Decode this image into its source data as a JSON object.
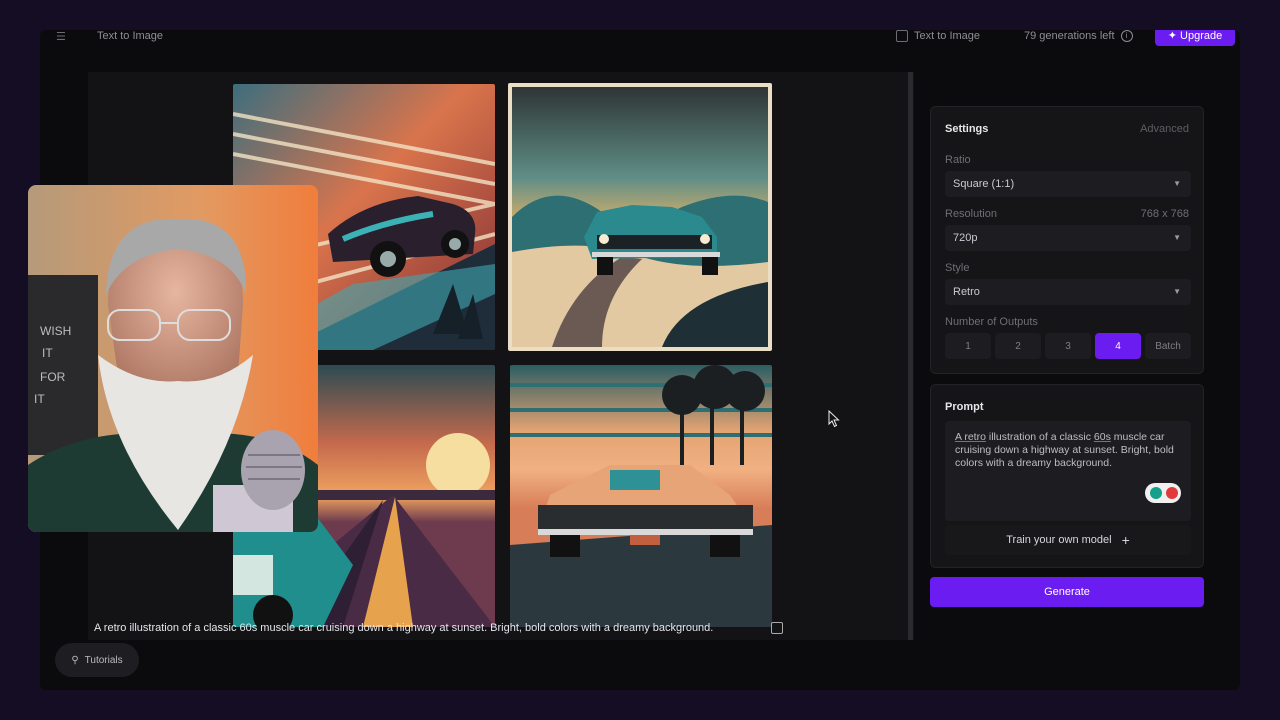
{
  "topbar": {
    "menu_icon": "menu-icon",
    "title": "Text to Image",
    "mode_label": "Text to Image",
    "generations_left": "79 generations left",
    "upgrade_label": "Upgrade"
  },
  "gallery": {
    "caption": "A retro illustration of a classic 60s muscle car cruising down a highway at sunset. Bright, bold colors with a dreamy background.",
    "images": [
      {
        "name": "result-image-1",
        "selected": false
      },
      {
        "name": "result-image-2",
        "selected": true
      },
      {
        "name": "result-image-3",
        "selected": false
      },
      {
        "name": "result-image-4",
        "selected": false
      }
    ]
  },
  "tutorials": {
    "label": "Tutorials",
    "icon": "lightbulb-icon"
  },
  "settings": {
    "title": "Settings",
    "advanced": "Advanced",
    "ratio_label": "Ratio",
    "ratio_value": "Square (1:1)",
    "resolution_label": "Resolution",
    "resolution_dims": "768 x 768",
    "resolution_value": "720p",
    "style_label": "Style",
    "style_value": "Retro",
    "outputs_label": "Number of Outputs",
    "outputs": [
      "1",
      "2",
      "3",
      "4",
      "Batch"
    ],
    "outputs_selected": "4"
  },
  "prompt": {
    "title": "Prompt",
    "text_part1": "A retro",
    "text_part2": " illustration of a classic ",
    "text_part3": "60s",
    "text_part4": " muscle car cruising down a highway at sunset. Bright, bold colors with a dreamy background.",
    "train_label": "Train your own model",
    "generate_label": "Generate"
  },
  "colors": {
    "accent": "#6b1cf0",
    "background": "#0b0b0d",
    "outer": "#140d24"
  }
}
